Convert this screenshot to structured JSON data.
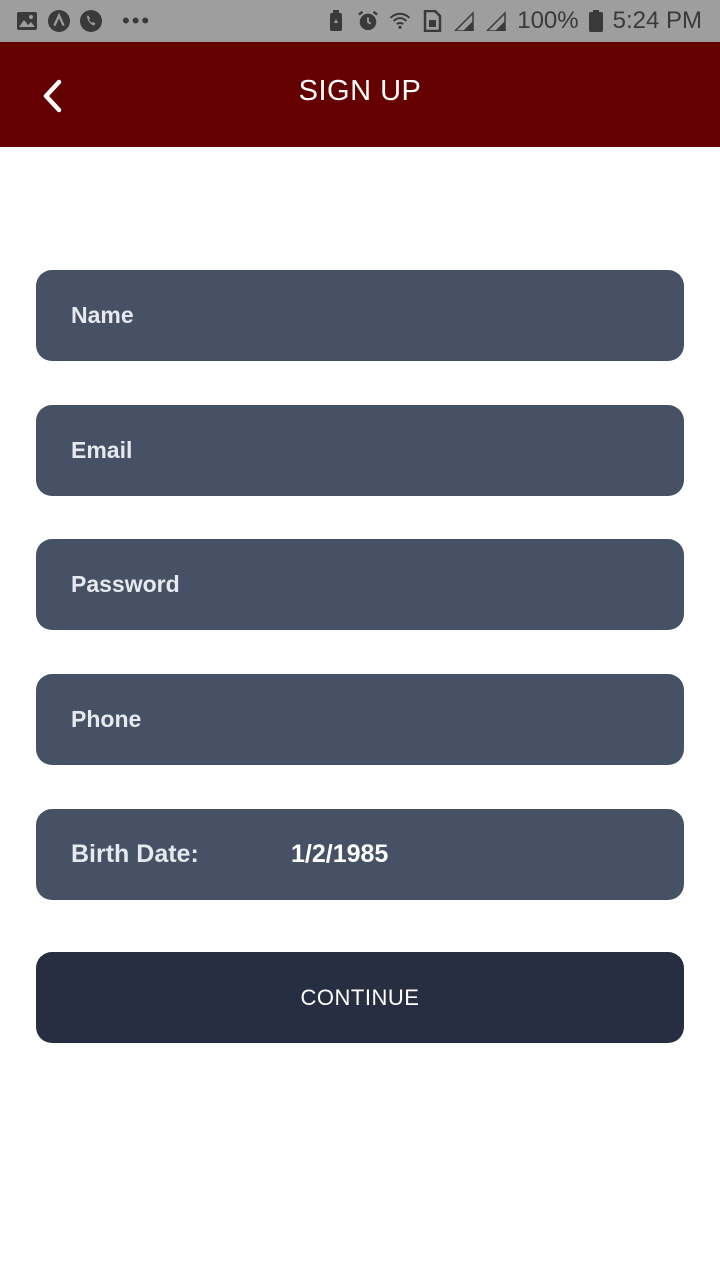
{
  "status_bar": {
    "battery_percent": "100%",
    "time": "5:24 PM",
    "left_icons": [
      "gallery-icon",
      "app-icon",
      "phone-icon",
      "more-dots-icon"
    ],
    "right_icons": [
      "battery-saver-icon",
      "alarm-icon",
      "wifi-icon",
      "sim-icon",
      "signal-icon",
      "signal-icon",
      "battery-icon"
    ],
    "background_color": "#9e9e9e"
  },
  "app_bar": {
    "title": "SIGN UP",
    "background_color": "#640000",
    "back_icon": "chevron-left-icon"
  },
  "form": {
    "name_placeholder": "Name",
    "name_value": "",
    "email_placeholder": "Email",
    "email_value": "",
    "password_placeholder": "Password",
    "password_value": "",
    "phone_placeholder": "Phone",
    "phone_value": "",
    "birth_date_label": "Birth Date:",
    "birth_date_value": "1/2/1985",
    "field_color": "#465165"
  },
  "continue_button": {
    "label": "CONTINUE",
    "color": "#282e42"
  }
}
